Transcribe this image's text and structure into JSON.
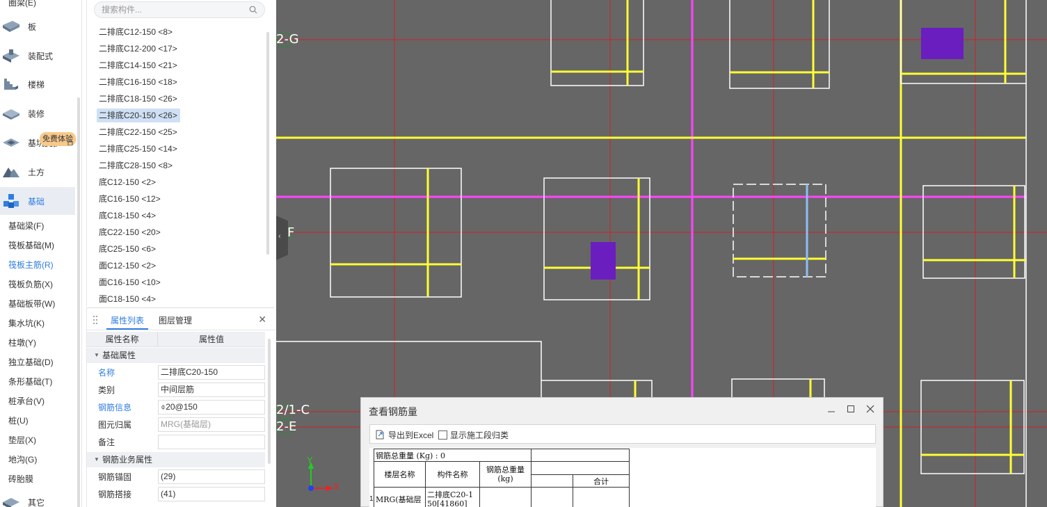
{
  "categories": {
    "top_clipped": "圈梁(E)",
    "items": [
      {
        "label": "板",
        "icon": "slab-icon"
      },
      {
        "label": "装配式",
        "icon": "prefab-icon"
      },
      {
        "label": "楼梯",
        "icon": "stair-icon"
      },
      {
        "label": "装修",
        "icon": "decoration-icon"
      },
      {
        "label": "基坑支护",
        "icon": "pit-support-icon"
      },
      {
        "label": "土方",
        "icon": "earthwork-icon"
      },
      {
        "label": "基础",
        "icon": "foundation-icon"
      },
      {
        "label": "其它",
        "icon": "other-icon"
      }
    ],
    "free_badge": "免费体验",
    "sub_items": [
      "基础梁(F)",
      "筏板基础(M)",
      "筏板主筋(R)",
      "筏板负筋(X)",
      "基础板带(W)",
      "集水坑(K)",
      "柱墩(Y)",
      "独立基础(D)",
      "条形基础(T)",
      "桩承台(V)",
      "桩(U)",
      "垫层(X)",
      "地沟(G)",
      "砖胎膜"
    ]
  },
  "component_panel": {
    "search_placeholder": "搜索构件...",
    "items": [
      "二排底C12-150 <8>",
      "二排底C12-200 <17>",
      "二排底C14-150 <21>",
      "二排底C16-150 <18>",
      "二排底C18-150 <26>",
      "二排底C20-150 <26>",
      "二排底C22-150 <25>",
      "二排底C25-150 <14>",
      "二排底C28-150 <8>",
      "底C12-150 <2>",
      "底C16-150 <12>",
      "底C18-150 <4>",
      "底C22-150 <20>",
      "底C25-150 <6>",
      "面C12-150 <2>",
      "面C16-150 <10>",
      "面C18-150 <4>"
    ],
    "selected_index": 5
  },
  "properties": {
    "tabs": [
      "属性列表",
      "图层管理"
    ],
    "col_name": "属性名称",
    "col_value": "属性值",
    "group_basic": "基础属性",
    "group_rebar": "钢筋业务属性",
    "rows": [
      {
        "name": "名称",
        "value": "二排底C20-150"
      },
      {
        "name": "类别",
        "value": "中间层筋"
      },
      {
        "name": "钢筋信息",
        "value": "⌽20@150"
      },
      {
        "name": "图元归属",
        "value": "MRG(基础层)"
      },
      {
        "name": "备注",
        "value": ""
      }
    ],
    "rebar_rows": [
      {
        "name": "钢筋锚固",
        "value": "(29)"
      },
      {
        "name": "钢筋搭接",
        "value": "(41)"
      }
    ]
  },
  "canvas": {
    "axis_labels": [
      "2-G",
      "F",
      "2/1-C",
      "2-E"
    ],
    "axis_x": "X",
    "axis_y": "Y",
    "colors": {
      "background": "#666666",
      "grid": "#d22020",
      "rebar": "#ffff33",
      "axis_magenta": "#ff44ff",
      "region": "#6a1ec0",
      "outline": "#ffffff"
    }
  },
  "dialog": {
    "title": "查看钢筋量",
    "export_label": "导出到Excel",
    "phase_label": "显示施工段归类",
    "table": {
      "total_weight": "钢筋总重量 (Kg) : 0",
      "h_floor": "楼层名称",
      "h_component": "构件名称",
      "h_total": "钢筋总重量\n(kg)",
      "h_sum": "合计",
      "row_index": "1",
      "row_floor": "MRG(基础层",
      "row_component": "二排底C20-1\n50[41860]"
    }
  }
}
